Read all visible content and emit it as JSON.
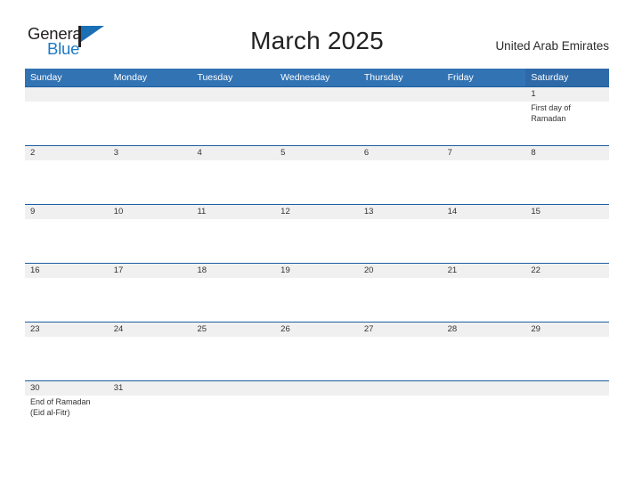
{
  "brand": {
    "name_top": "General",
    "name_bottom": "Blue",
    "flag_icon": "flag-triangle-icon",
    "accent_color": "#1f7ac4"
  },
  "header": {
    "title": "March 2025",
    "region": "United Arab Emirates"
  },
  "colors": {
    "header_blue": "#3273b4",
    "saturday_blue": "#2e6aa8",
    "row_rule_blue": "#1c5fa0",
    "day_band_gray": "#f0f0f0",
    "text_dark": "#333333"
  },
  "calendar": {
    "weekdays": [
      "Sunday",
      "Monday",
      "Tuesday",
      "Wednesday",
      "Thursday",
      "Friday",
      "Saturday"
    ],
    "weeks": [
      {
        "days": [
          {
            "num": "",
            "events": []
          },
          {
            "num": "",
            "events": []
          },
          {
            "num": "",
            "events": []
          },
          {
            "num": "",
            "events": []
          },
          {
            "num": "",
            "events": []
          },
          {
            "num": "",
            "events": []
          },
          {
            "num": "1",
            "events": [
              "First day of",
              "Ramadan"
            ]
          }
        ]
      },
      {
        "days": [
          {
            "num": "2",
            "events": []
          },
          {
            "num": "3",
            "events": []
          },
          {
            "num": "4",
            "events": []
          },
          {
            "num": "5",
            "events": []
          },
          {
            "num": "6",
            "events": []
          },
          {
            "num": "7",
            "events": []
          },
          {
            "num": "8",
            "events": []
          }
        ]
      },
      {
        "days": [
          {
            "num": "9",
            "events": []
          },
          {
            "num": "10",
            "events": []
          },
          {
            "num": "11",
            "events": []
          },
          {
            "num": "12",
            "events": []
          },
          {
            "num": "13",
            "events": []
          },
          {
            "num": "14",
            "events": []
          },
          {
            "num": "15",
            "events": []
          }
        ]
      },
      {
        "days": [
          {
            "num": "16",
            "events": []
          },
          {
            "num": "17",
            "events": []
          },
          {
            "num": "18",
            "events": []
          },
          {
            "num": "19",
            "events": []
          },
          {
            "num": "20",
            "events": []
          },
          {
            "num": "21",
            "events": []
          },
          {
            "num": "22",
            "events": []
          }
        ]
      },
      {
        "days": [
          {
            "num": "23",
            "events": []
          },
          {
            "num": "24",
            "events": []
          },
          {
            "num": "25",
            "events": []
          },
          {
            "num": "26",
            "events": []
          },
          {
            "num": "27",
            "events": []
          },
          {
            "num": "28",
            "events": []
          },
          {
            "num": "29",
            "events": []
          }
        ]
      },
      {
        "days": [
          {
            "num": "30",
            "events": [
              "End of Ramadan",
              "(Eid al-Fitr)"
            ]
          },
          {
            "num": "31",
            "events": []
          },
          {
            "num": "",
            "events": []
          },
          {
            "num": "",
            "events": []
          },
          {
            "num": "",
            "events": []
          },
          {
            "num": "",
            "events": []
          },
          {
            "num": "",
            "events": []
          }
        ]
      }
    ]
  }
}
